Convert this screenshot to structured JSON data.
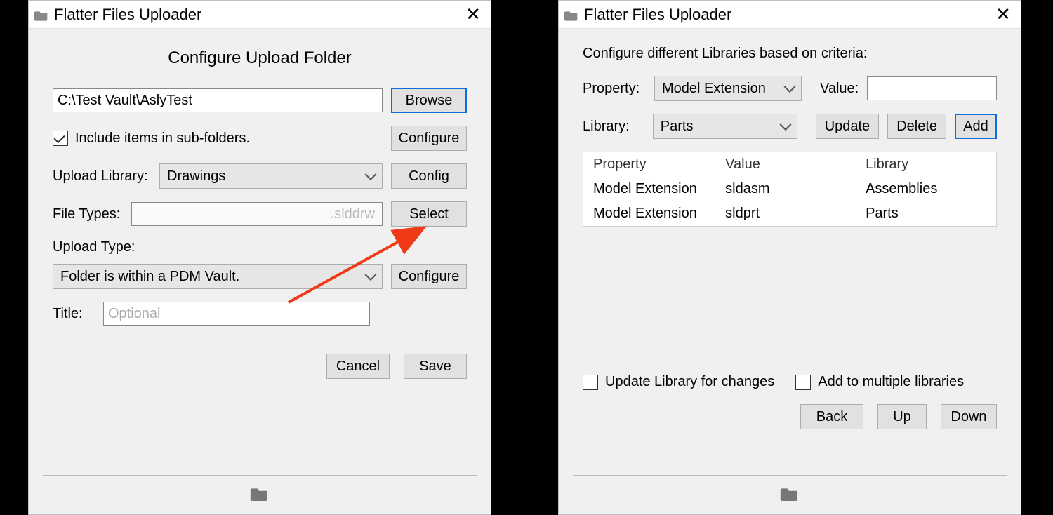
{
  "left": {
    "title": "Flatter Files Uploader",
    "heading": "Configure Upload Folder",
    "path_value": "C:\\Test Vault\\AslyTest",
    "browse": "Browse",
    "include_sub_label": "Include items in sub-folders.",
    "include_sub_checked": true,
    "configure": "Configure",
    "upload_library_label": "Upload Library:",
    "upload_library_value": "Drawings",
    "config": "Config",
    "file_types_label": "File Types:",
    "file_types_value": ".slddrw",
    "select": "Select",
    "upload_type_label": "Upload Type:",
    "upload_type_value": "Folder is within a PDM Vault.",
    "configure2": "Configure",
    "title_label": "Title:",
    "title_placeholder": "Optional",
    "cancel": "Cancel",
    "save": "Save"
  },
  "right": {
    "title": "Flatter Files Uploader",
    "heading": "Configure different Libraries based on criteria:",
    "property_label": "Property:",
    "property_value": "Model Extension",
    "value_label": "Value:",
    "value_value": "",
    "library_label": "Library:",
    "library_value": "Parts",
    "update": "Update",
    "delete": "Delete",
    "add": "Add",
    "col_property": "Property",
    "col_value": "Value",
    "col_library": "Library",
    "rows": [
      {
        "property": "Model Extension",
        "value": "sldasm",
        "library": "Assemblies"
      },
      {
        "property": "Model Extension",
        "value": "sldprt",
        "library": "Parts"
      }
    ],
    "update_lib_label": "Update Library for changes",
    "add_multi_label": "Add to multiple libraries",
    "back": "Back",
    "up": "Up",
    "down": "Down"
  }
}
